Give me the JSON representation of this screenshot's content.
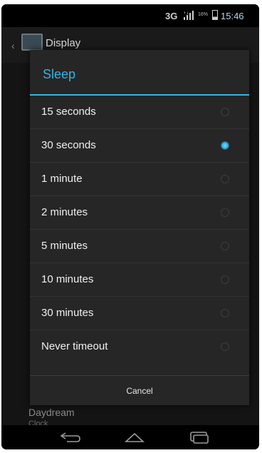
{
  "status_bar": {
    "network": "3G",
    "battery_percent": "16%",
    "battery_level": 0.16,
    "time": "15:46"
  },
  "background": {
    "title": "Display",
    "items": [
      "Daydream"
    ],
    "subitem": "Clock"
  },
  "dialog": {
    "title": "Sleep",
    "options": [
      {
        "label": "15 seconds",
        "selected": false
      },
      {
        "label": "30 seconds",
        "selected": true
      },
      {
        "label": "1 minute",
        "selected": false
      },
      {
        "label": "2 minutes",
        "selected": false
      },
      {
        "label": "5 minutes",
        "selected": false
      },
      {
        "label": "10 minutes",
        "selected": false
      },
      {
        "label": "30 minutes",
        "selected": false
      },
      {
        "label": "Never timeout",
        "selected": false
      }
    ],
    "cancel_label": "Cancel"
  },
  "colors": {
    "accent": "#33b5e5",
    "dialog_bg": "#262626"
  },
  "icons": [
    "signal-icon",
    "battery-icon",
    "back-icon",
    "display-app-icon",
    "radio-icon",
    "nav-back-icon",
    "nav-home-icon",
    "nav-recent-apps-icon"
  ]
}
